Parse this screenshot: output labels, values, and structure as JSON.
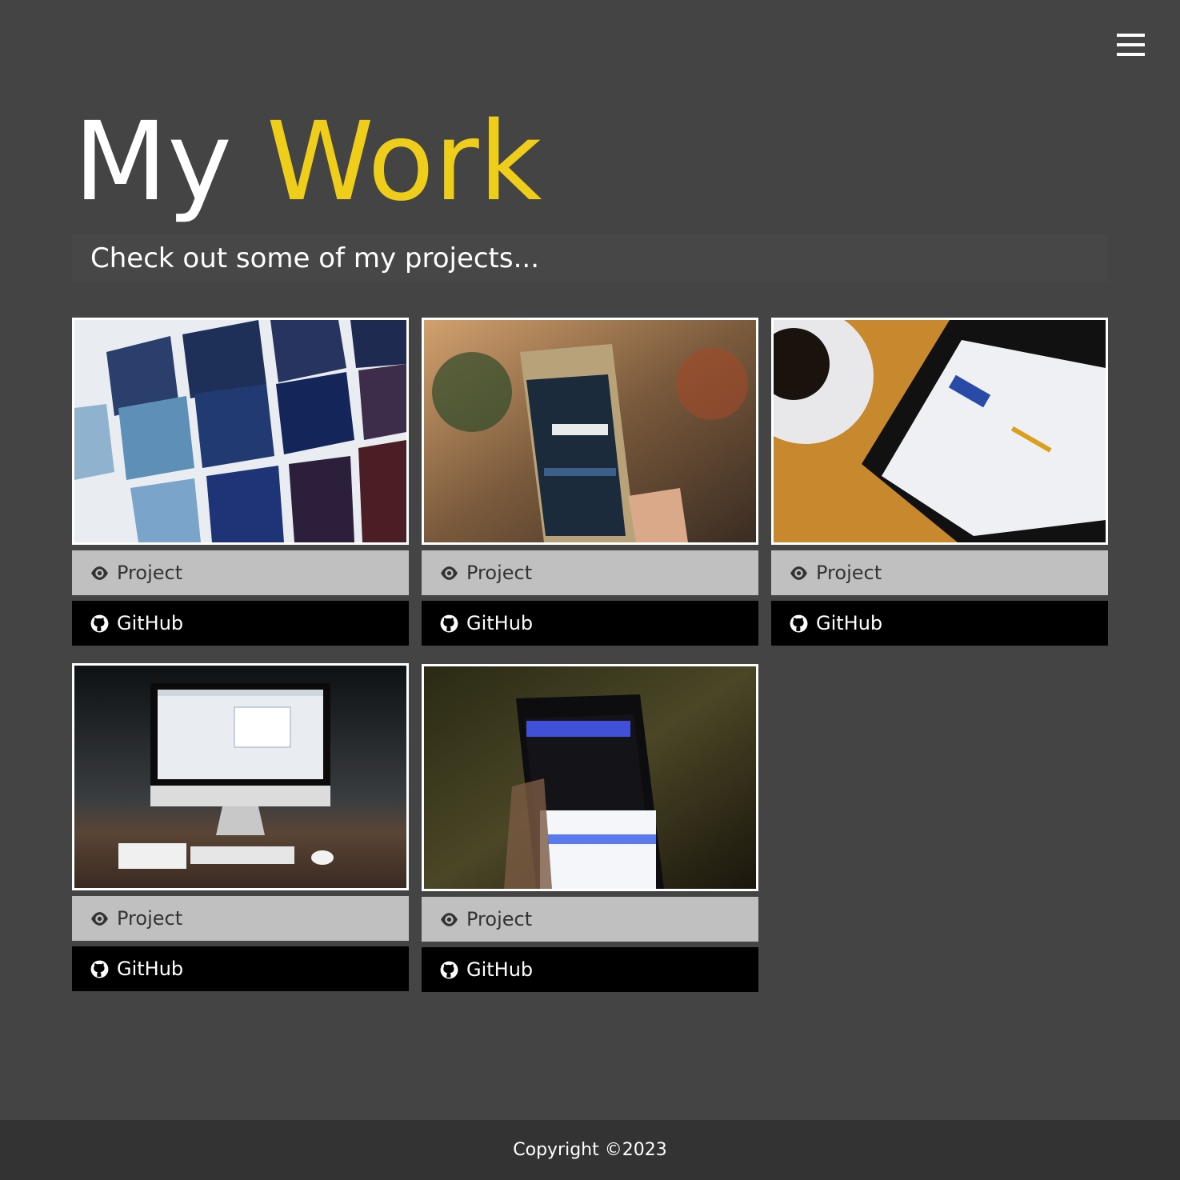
{
  "header": {
    "menu_icon": "hamburger-menu-icon",
    "title_part1": "My",
    "title_part2": "Work",
    "accent_color": "#eece1a",
    "subtitle": "Check out some of my projects..."
  },
  "projects": [
    {
      "image_alt": "Media app tiles",
      "project_label": "Project",
      "github_label": "GitHub"
    },
    {
      "image_alt": "Phone showing Pexels",
      "project_label": "Project",
      "github_label": "GitHub"
    },
    {
      "image_alt": "Tablet with Chronos Workflow",
      "project_label": "Project",
      "github_label": "GitHub"
    },
    {
      "image_alt": "iMac desk setup",
      "project_label": "Project",
      "github_label": "GitHub"
    },
    {
      "image_alt": "Phone in dark room",
      "project_label": "Project",
      "github_label": "GitHub"
    }
  ],
  "icons": {
    "project": "eye-icon",
    "github": "github-icon"
  },
  "footer": {
    "copyright": "Copyright ©2023"
  }
}
